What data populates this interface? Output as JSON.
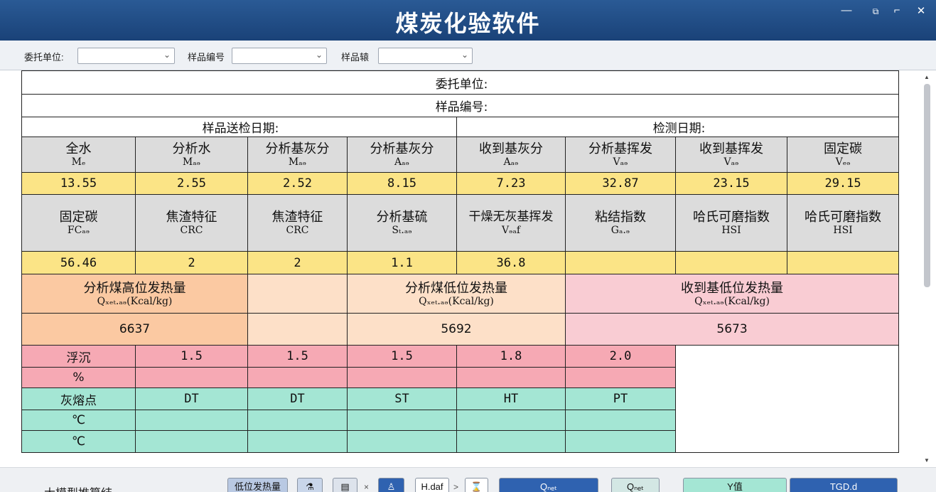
{
  "window": {
    "title": "煤炭化验软件",
    "minimize_glyph": "—",
    "restore_glyph": "⧉",
    "maximize_glyph": "⌐",
    "close_glyph": "✕"
  },
  "filters": {
    "client_label": "委托单位:",
    "sample_no_label": "样品编号",
    "sample_kind_label": "样品辕",
    "chevron": "⌄"
  },
  "header": {
    "client_label": "委托单位:",
    "sample_no_label": "样品编号:",
    "send_date_label": "样品送检日期:",
    "test_date_label": "检测日期:"
  },
  "row1": {
    "names": [
      "全水",
      "分析水",
      "分析基灰分",
      "分析基灰分",
      "收到基灰分",
      "分析基挥发",
      "收到基挥发",
      "固定碳"
    ],
    "symbols": [
      "Mₑ",
      "Mₐₔ",
      "Mₐₔ",
      "Aₐₔ",
      "Aₐₔ",
      "Vₐₔ",
      "Vₐₔ",
      "Vₑₔ"
    ],
    "values": [
      "13.55",
      "2.55",
      "2.52",
      "8.15",
      "7.23",
      "32.87",
      "23.15",
      "29.15"
    ]
  },
  "row2": {
    "names": [
      "固定碳",
      "焦渣特征",
      "焦渣特征",
      "分析基硫",
      "干燥无灰基挥发",
      "粘结指数",
      "哈氏可磨指数",
      "哈氏可磨指数"
    ],
    "symbols": [
      "FCₐₔ",
      "CRC",
      "CRC",
      "Sₜ.ₐₔ",
      "Vₔₐf",
      "Gₐ.ₔ",
      "HSI",
      "HSI"
    ],
    "values": [
      "56.46",
      "2",
      "2",
      "1.1",
      "36.8",
      "",
      "",
      ""
    ]
  },
  "heat": {
    "gross_name": "分析煤高位发热量",
    "gross_sym": "Qₓₑₜ.ₐₔ(Kcal/kg)",
    "gross_value": "6637",
    "net_ad_name": "分析煤低位发热量",
    "net_ad_sym": "Qₓₑₜ.ₐₔ(Kcal/kg)",
    "net_ad_value": "5692",
    "net_ar_name": "收到基低位发热量",
    "net_ar_sym": "Qₓₑₜ.ₐₔ(Kcal/kg)",
    "net_ar_value": "5673"
  },
  "float": {
    "label": "浮沉",
    "values": [
      "1.5",
      "1.5",
      "1.5",
      "1.8",
      "2.0"
    ],
    "pct_label": "%"
  },
  "ash": {
    "label": "灰熔点",
    "points": [
      "DT",
      "DT",
      "ST",
      "HT",
      "PT"
    ],
    "unit1": "℃",
    "unit2": "℃"
  },
  "bottom": {
    "title": "大模型推算结",
    "b1": "低位发热量",
    "b5": "H.daf",
    "b6": "Qₙₑₜ",
    "b7": "Qₙₑₜ",
    "b8": "Y值",
    "b9": "TGD.d",
    "x_glyph": "×",
    "gt_glyph": ">"
  },
  "colors": {
    "title_bar": "#1a4278",
    "yellow": "#fbe486",
    "orange": "#fbc9a2",
    "pink": "#f9ccd3",
    "rose": "#f6a9b4",
    "teal": "#a4e6d4",
    "gray": "#dcdcdc"
  }
}
